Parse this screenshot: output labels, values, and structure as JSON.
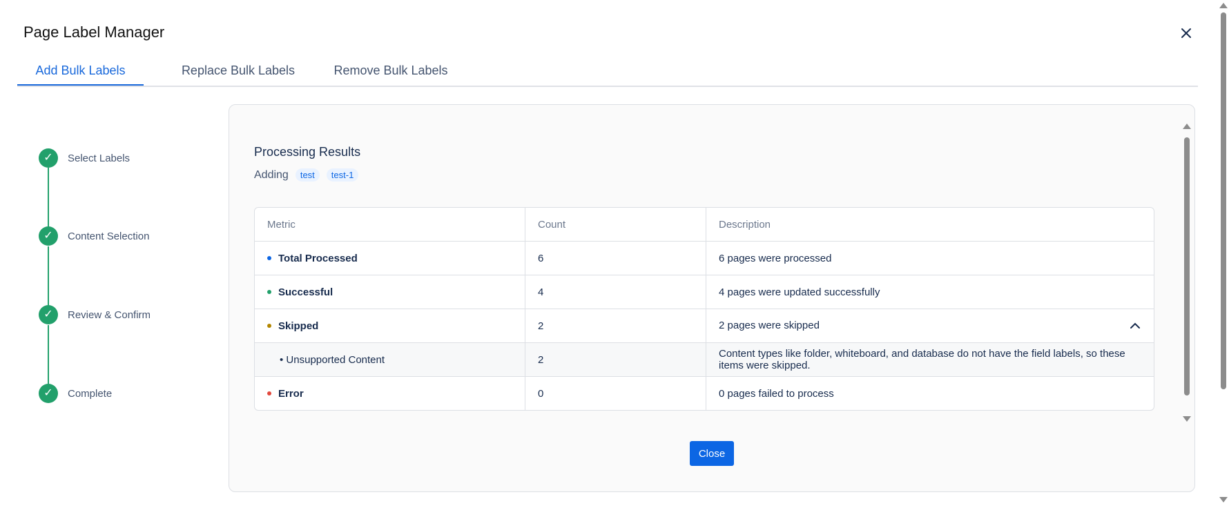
{
  "dialog": {
    "title": "Page Label Manager"
  },
  "tabs": [
    {
      "label": "Add Bulk Labels",
      "active": true
    },
    {
      "label": "Replace Bulk Labels",
      "active": false
    },
    {
      "label": "Remove Bulk Labels",
      "active": false
    }
  ],
  "steps": [
    {
      "label": "Select Labels",
      "status": "complete"
    },
    {
      "label": "Content Selection",
      "status": "complete"
    },
    {
      "label": "Review & Confirm",
      "status": "complete"
    },
    {
      "label": "Complete",
      "status": "complete"
    }
  ],
  "results": {
    "title": "Processing Results",
    "adding_label": "Adding",
    "labels": [
      "test",
      "test-1"
    ],
    "columns": [
      "Metric",
      "Count",
      "Description"
    ],
    "rows": [
      {
        "metric": "Total Processed",
        "count": "6",
        "description": "6 pages were processed",
        "dot_color": "#0c66e4"
      },
      {
        "metric": "Successful",
        "count": "4",
        "description": "4 pages were updated successfully",
        "dot_color": "#22a06b"
      },
      {
        "metric": "Skipped",
        "count": "2",
        "description": "2 pages were skipped",
        "dot_color": "#b38600",
        "expanded": true
      },
      {
        "metric": "Unsupported Content",
        "count": "2",
        "description": "Content types like folder, whiteboard, and database do not have the field labels, so these items were skipped.",
        "sub": true
      },
      {
        "metric": "Error",
        "count": "0",
        "description": "0 pages failed to process",
        "dot_color": "#e2483d"
      }
    ]
  },
  "close_button": "Close",
  "icons": {
    "close": "close-icon",
    "check": "check-icon",
    "chevron": "chevron-up-icon"
  }
}
